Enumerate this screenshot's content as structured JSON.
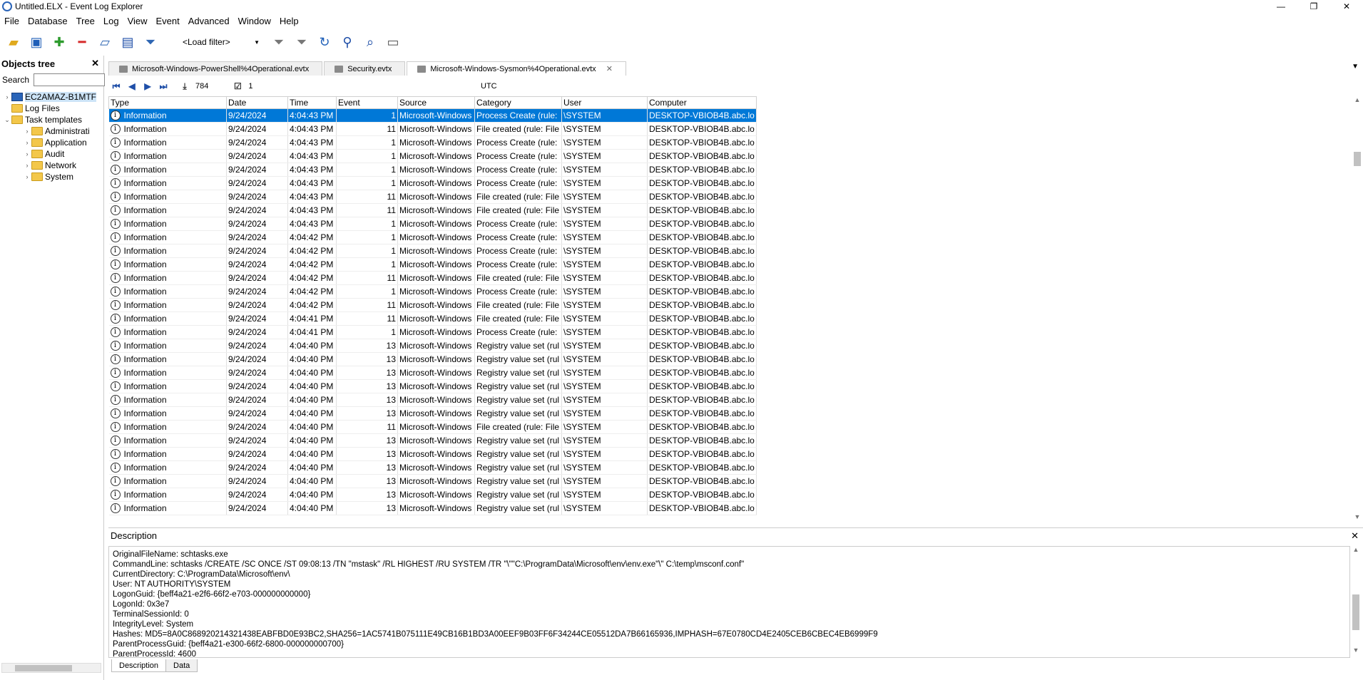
{
  "window": {
    "title": "Untitled.ELX - Event Log Explorer",
    "minimize": "—",
    "restore": "❐",
    "close": "✕"
  },
  "menu": [
    "File",
    "Database",
    "Tree",
    "Log",
    "View",
    "Event",
    "Advanced",
    "Window",
    "Help"
  ],
  "toolbar": {
    "filter_placeholder": "<Load filter>",
    "icons": [
      "new-computer-icon",
      "add-computer-icon",
      "new-log-icon",
      "remove-icon",
      "open-icon",
      "save-icon",
      "filter-icon",
      "filter-remove-icon",
      "filter-edit-icon",
      "refresh-icon",
      "find-icon",
      "find-preview-icon",
      "print-icon"
    ]
  },
  "objects_tree": {
    "title": "Objects tree",
    "search_label": "Search",
    "items": [
      {
        "label": "EC2AMAZ-B1MTF",
        "level": 0,
        "type": "computer",
        "expander": "›"
      },
      {
        "label": "Log Files",
        "level": 0,
        "type": "folder",
        "expander": ""
      },
      {
        "label": "Task templates",
        "level": 0,
        "type": "folder",
        "expander": "⌄"
      },
      {
        "label": "Administrati",
        "level": 1,
        "type": "folder",
        "expander": "›"
      },
      {
        "label": "Application",
        "level": 1,
        "type": "folder",
        "expander": "›"
      },
      {
        "label": "Audit",
        "level": 1,
        "type": "folder",
        "expander": "›"
      },
      {
        "label": "Network",
        "level": 1,
        "type": "folder",
        "expander": "›"
      },
      {
        "label": "System",
        "level": 1,
        "type": "folder",
        "expander": "›"
      }
    ]
  },
  "tabs": [
    {
      "label": "Microsoft-Windows-PowerShell%4Operational.evtx",
      "active": false
    },
    {
      "label": "Security.evtx",
      "active": false
    },
    {
      "label": "Microsoft-Windows-Sysmon%4Operational.evtx",
      "active": true
    }
  ],
  "nav": {
    "count": "784",
    "checked": "1",
    "timezone": "UTC"
  },
  "columns": [
    "Type",
    "Date",
    "Time",
    "Event",
    "Source",
    "Category",
    "User",
    "Computer"
  ],
  "rows": [
    [
      "Information",
      "9/24/2024",
      "4:04:43 PM",
      "1",
      "Microsoft-Windows",
      "Process Create (rule:",
      "\\SYSTEM",
      "DESKTOP-VBIOB4B.abc.lo"
    ],
    [
      "Information",
      "9/24/2024",
      "4:04:43 PM",
      "11",
      "Microsoft-Windows",
      "File created (rule: File",
      "\\SYSTEM",
      "DESKTOP-VBIOB4B.abc.lo"
    ],
    [
      "Information",
      "9/24/2024",
      "4:04:43 PM",
      "1",
      "Microsoft-Windows",
      "Process Create (rule:",
      "\\SYSTEM",
      "DESKTOP-VBIOB4B.abc.lo"
    ],
    [
      "Information",
      "9/24/2024",
      "4:04:43 PM",
      "1",
      "Microsoft-Windows",
      "Process Create (rule:",
      "\\SYSTEM",
      "DESKTOP-VBIOB4B.abc.lo"
    ],
    [
      "Information",
      "9/24/2024",
      "4:04:43 PM",
      "1",
      "Microsoft-Windows",
      "Process Create (rule:",
      "\\SYSTEM",
      "DESKTOP-VBIOB4B.abc.lo"
    ],
    [
      "Information",
      "9/24/2024",
      "4:04:43 PM",
      "1",
      "Microsoft-Windows",
      "Process Create (rule:",
      "\\SYSTEM",
      "DESKTOP-VBIOB4B.abc.lo"
    ],
    [
      "Information",
      "9/24/2024",
      "4:04:43 PM",
      "11",
      "Microsoft-Windows",
      "File created (rule: File",
      "\\SYSTEM",
      "DESKTOP-VBIOB4B.abc.lo"
    ],
    [
      "Information",
      "9/24/2024",
      "4:04:43 PM",
      "11",
      "Microsoft-Windows",
      "File created (rule: File",
      "\\SYSTEM",
      "DESKTOP-VBIOB4B.abc.lo"
    ],
    [
      "Information",
      "9/24/2024",
      "4:04:43 PM",
      "1",
      "Microsoft-Windows",
      "Process Create (rule:",
      "\\SYSTEM",
      "DESKTOP-VBIOB4B.abc.lo"
    ],
    [
      "Information",
      "9/24/2024",
      "4:04:42 PM",
      "1",
      "Microsoft-Windows",
      "Process Create (rule:",
      "\\SYSTEM",
      "DESKTOP-VBIOB4B.abc.lo"
    ],
    [
      "Information",
      "9/24/2024",
      "4:04:42 PM",
      "1",
      "Microsoft-Windows",
      "Process Create (rule:",
      "\\SYSTEM",
      "DESKTOP-VBIOB4B.abc.lo"
    ],
    [
      "Information",
      "9/24/2024",
      "4:04:42 PM",
      "1",
      "Microsoft-Windows",
      "Process Create (rule:",
      "\\SYSTEM",
      "DESKTOP-VBIOB4B.abc.lo"
    ],
    [
      "Information",
      "9/24/2024",
      "4:04:42 PM",
      "11",
      "Microsoft-Windows",
      "File created (rule: File",
      "\\SYSTEM",
      "DESKTOP-VBIOB4B.abc.lo"
    ],
    [
      "Information",
      "9/24/2024",
      "4:04:42 PM",
      "1",
      "Microsoft-Windows",
      "Process Create (rule:",
      "\\SYSTEM",
      "DESKTOP-VBIOB4B.abc.lo"
    ],
    [
      "Information",
      "9/24/2024",
      "4:04:42 PM",
      "11",
      "Microsoft-Windows",
      "File created (rule: File",
      "\\SYSTEM",
      "DESKTOP-VBIOB4B.abc.lo"
    ],
    [
      "Information",
      "9/24/2024",
      "4:04:41 PM",
      "11",
      "Microsoft-Windows",
      "File created (rule: File",
      "\\SYSTEM",
      "DESKTOP-VBIOB4B.abc.lo"
    ],
    [
      "Information",
      "9/24/2024",
      "4:04:41 PM",
      "1",
      "Microsoft-Windows",
      "Process Create (rule:",
      "\\SYSTEM",
      "DESKTOP-VBIOB4B.abc.lo"
    ],
    [
      "Information",
      "9/24/2024",
      "4:04:40 PM",
      "13",
      "Microsoft-Windows",
      "Registry value set (rul",
      "\\SYSTEM",
      "DESKTOP-VBIOB4B.abc.lo"
    ],
    [
      "Information",
      "9/24/2024",
      "4:04:40 PM",
      "13",
      "Microsoft-Windows",
      "Registry value set (rul",
      "\\SYSTEM",
      "DESKTOP-VBIOB4B.abc.lo"
    ],
    [
      "Information",
      "9/24/2024",
      "4:04:40 PM",
      "13",
      "Microsoft-Windows",
      "Registry value set (rul",
      "\\SYSTEM",
      "DESKTOP-VBIOB4B.abc.lo"
    ],
    [
      "Information",
      "9/24/2024",
      "4:04:40 PM",
      "13",
      "Microsoft-Windows",
      "Registry value set (rul",
      "\\SYSTEM",
      "DESKTOP-VBIOB4B.abc.lo"
    ],
    [
      "Information",
      "9/24/2024",
      "4:04:40 PM",
      "13",
      "Microsoft-Windows",
      "Registry value set (rul",
      "\\SYSTEM",
      "DESKTOP-VBIOB4B.abc.lo"
    ],
    [
      "Information",
      "9/24/2024",
      "4:04:40 PM",
      "13",
      "Microsoft-Windows",
      "Registry value set (rul",
      "\\SYSTEM",
      "DESKTOP-VBIOB4B.abc.lo"
    ],
    [
      "Information",
      "9/24/2024",
      "4:04:40 PM",
      "11",
      "Microsoft-Windows",
      "File created (rule: File",
      "\\SYSTEM",
      "DESKTOP-VBIOB4B.abc.lo"
    ],
    [
      "Information",
      "9/24/2024",
      "4:04:40 PM",
      "13",
      "Microsoft-Windows",
      "Registry value set (rul",
      "\\SYSTEM",
      "DESKTOP-VBIOB4B.abc.lo"
    ],
    [
      "Information",
      "9/24/2024",
      "4:04:40 PM",
      "13",
      "Microsoft-Windows",
      "Registry value set (rul",
      "\\SYSTEM",
      "DESKTOP-VBIOB4B.abc.lo"
    ],
    [
      "Information",
      "9/24/2024",
      "4:04:40 PM",
      "13",
      "Microsoft-Windows",
      "Registry value set (rul",
      "\\SYSTEM",
      "DESKTOP-VBIOB4B.abc.lo"
    ],
    [
      "Information",
      "9/24/2024",
      "4:04:40 PM",
      "13",
      "Microsoft-Windows",
      "Registry value set (rul",
      "\\SYSTEM",
      "DESKTOP-VBIOB4B.abc.lo"
    ],
    [
      "Information",
      "9/24/2024",
      "4:04:40 PM",
      "13",
      "Microsoft-Windows",
      "Registry value set (rul",
      "\\SYSTEM",
      "DESKTOP-VBIOB4B.abc.lo"
    ],
    [
      "Information",
      "9/24/2024",
      "4:04:40 PM",
      "13",
      "Microsoft-Windows",
      "Registry value set (rul",
      "\\SYSTEM",
      "DESKTOP-VBIOB4B.abc.lo"
    ]
  ],
  "description": {
    "title": "Description",
    "lines": [
      "OriginalFileName: schtasks.exe",
      "CommandLine: schtasks  /CREATE /SC ONCE /ST 09:08:13 /TN \"mstask\" /RL HIGHEST /RU SYSTEM /TR \"\\\"\"C:\\ProgramData\\Microsoft\\env\\env.exe\"\\\" C:\\temp\\msconf.conf\"",
      "CurrentDirectory: C:\\ProgramData\\Microsoft\\env\\",
      "User: NT AUTHORITY\\SYSTEM",
      "LogonGuid: {beff4a21-e2f6-66f2-e703-000000000000}",
      "LogonId: 0x3e7",
      "TerminalSessionId: 0",
      "IntegrityLevel: System",
      "Hashes: MD5=8A0C868920214321438EABFBD0E93BC2,SHA256=1AC5741B075111E49CB16B1BD3A00EEF9B03FF6F34244CE05512DA7B66165936,IMPHASH=67E0780CD4E2405CEB6CBEC4EB6999F9",
      "ParentProcessGuid: {beff4a21-e300-66f2-6800-000000000700}",
      "ParentProcessId: 4600"
    ],
    "tabs": [
      "Description",
      "Data"
    ]
  },
  "colors": {
    "selection": "#0078d7",
    "accent": "#2a64b8"
  }
}
